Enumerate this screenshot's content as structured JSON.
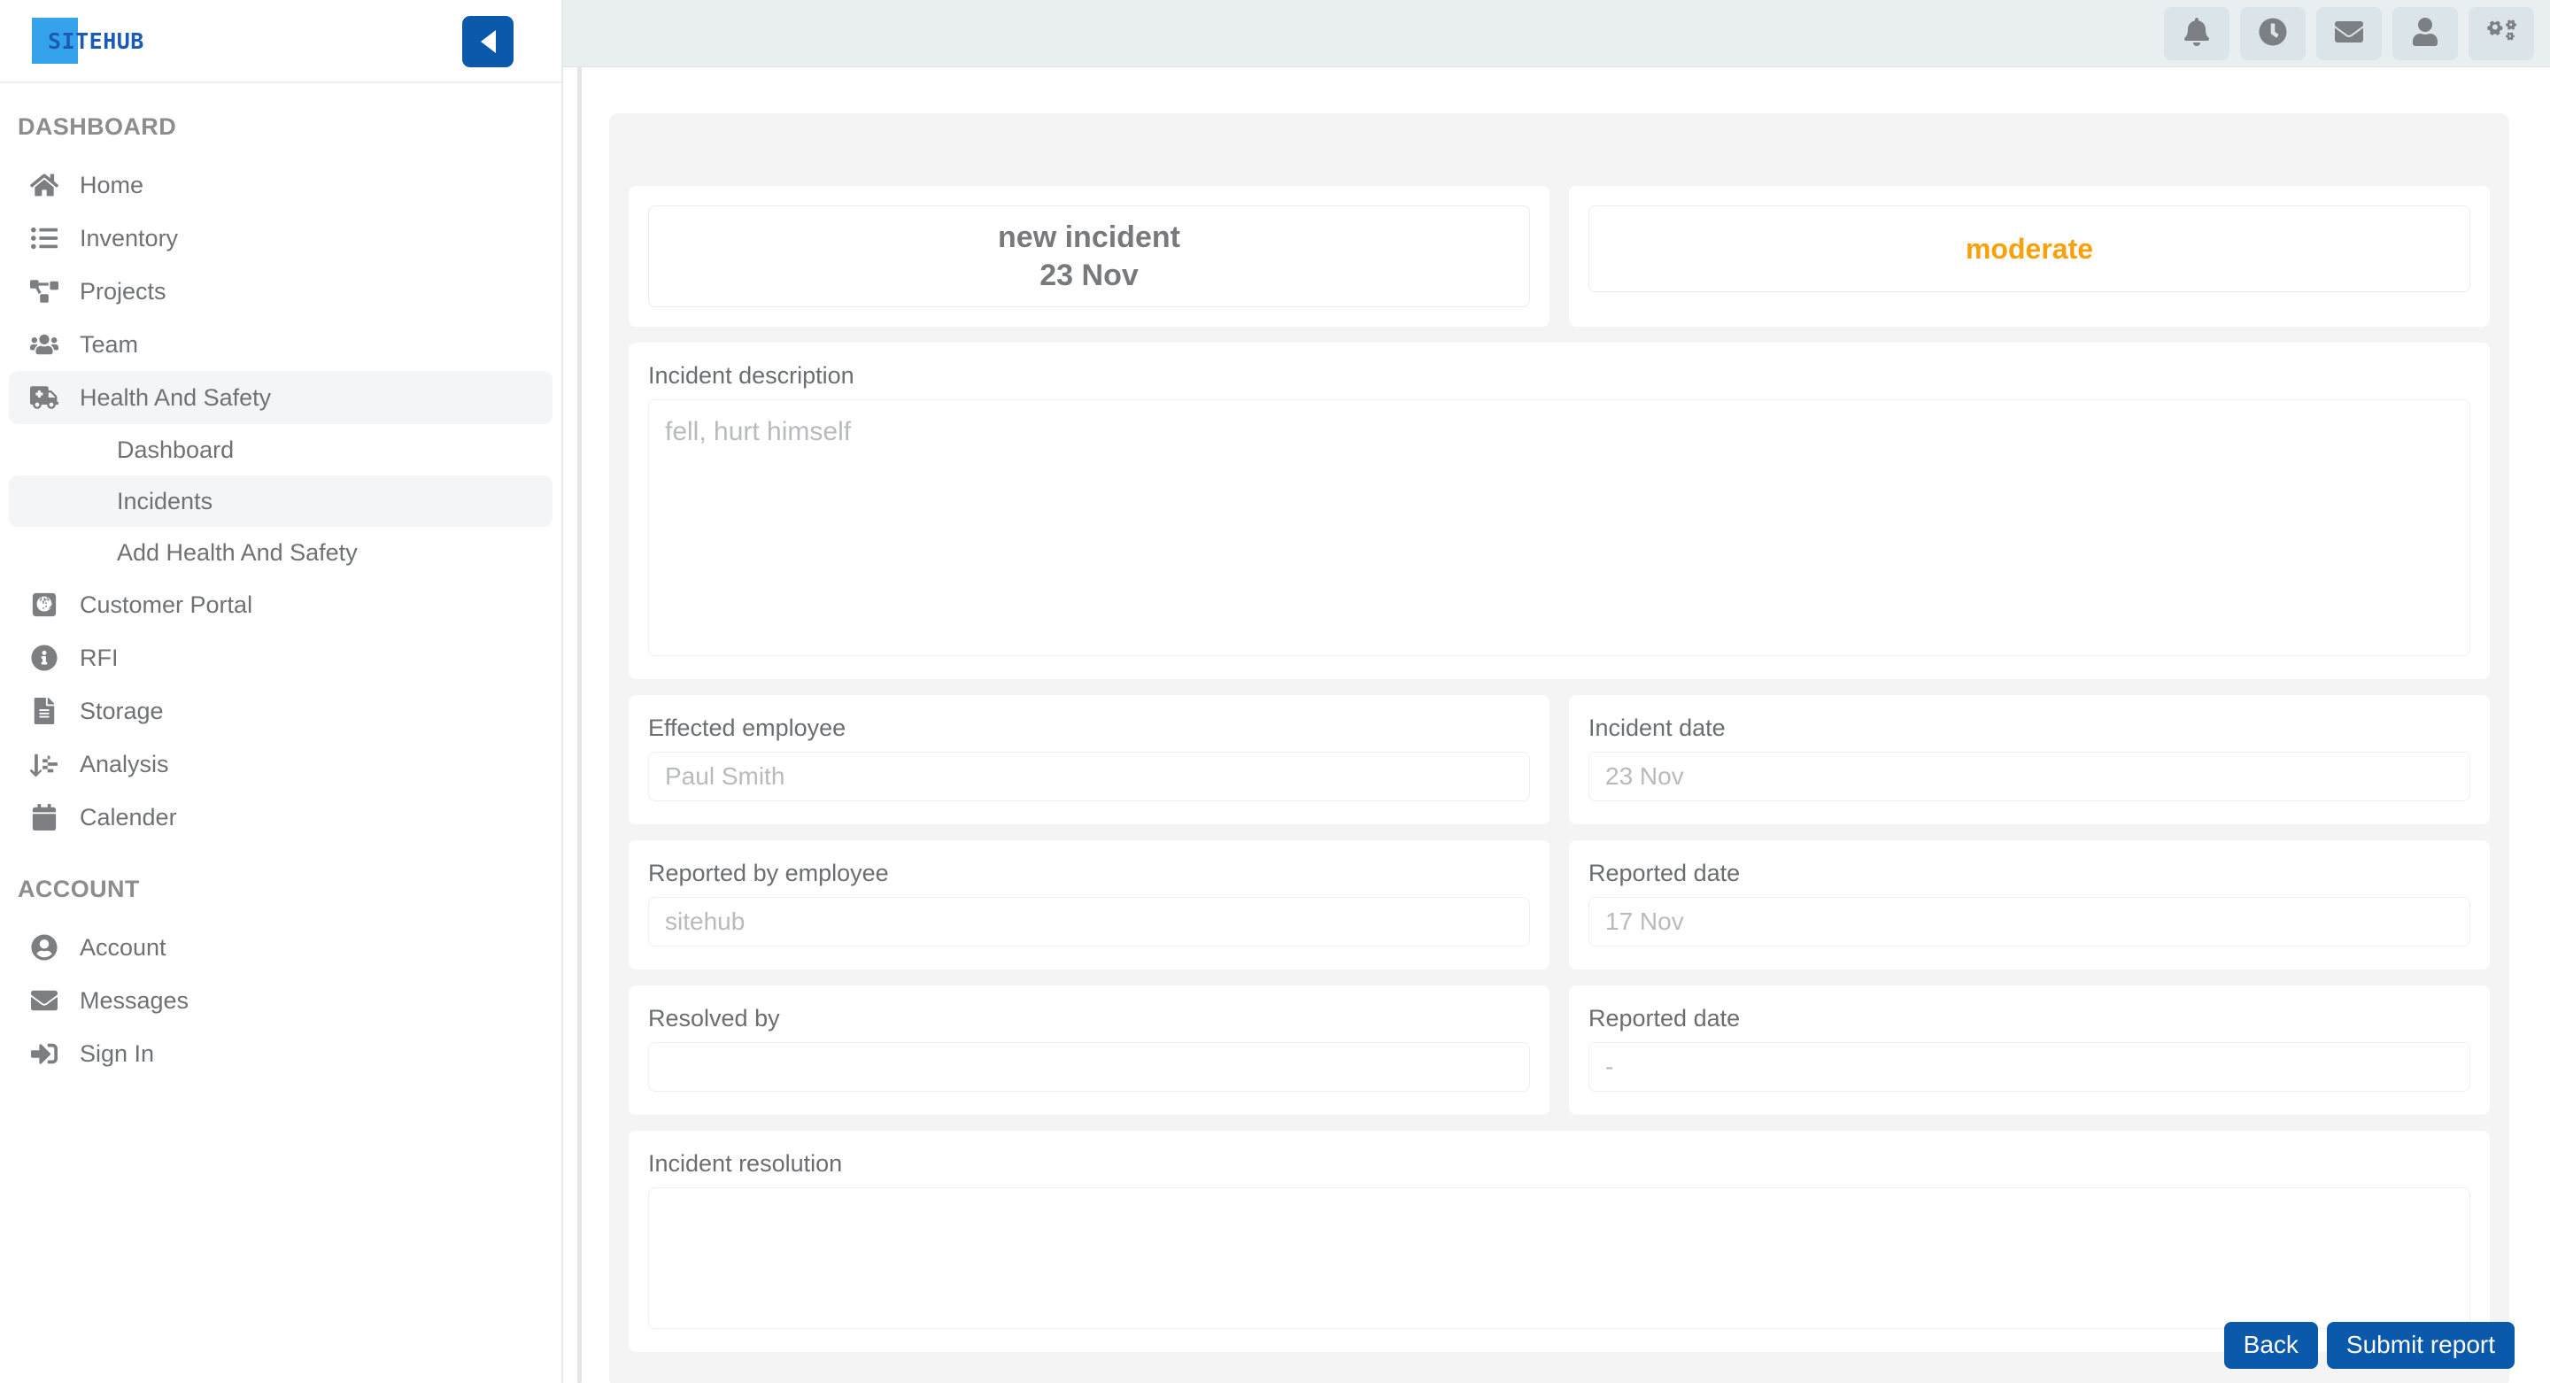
{
  "brand": {
    "name": "SITEHUB"
  },
  "sidebar": {
    "collapse_label": "collapse-sidebar",
    "sections": [
      {
        "title": "DASHBOARD",
        "items": [
          {
            "label": "Home",
            "icon": "home-icon",
            "active": false
          },
          {
            "label": "Inventory",
            "icon": "list-icon",
            "active": false
          },
          {
            "label": "Projects",
            "icon": "project-diagram-icon",
            "active": false
          },
          {
            "label": "Team",
            "icon": "users-icon",
            "active": false
          },
          {
            "label": "Health And Safety",
            "icon": "ambulance-icon",
            "active": true,
            "children": [
              {
                "label": "Dashboard",
                "active": false
              },
              {
                "label": "Incidents",
                "active": true
              },
              {
                "label": "Add Health And Safety",
                "active": false
              }
            ]
          },
          {
            "label": "Customer Portal",
            "icon": "passport-icon",
            "active": false
          },
          {
            "label": "RFI",
            "icon": "info-circle-icon",
            "active": false
          },
          {
            "label": "Storage",
            "icon": "file-alt-icon",
            "active": false
          },
          {
            "label": "Analysis",
            "icon": "sort-amount-down-icon",
            "active": false
          },
          {
            "label": "Calender",
            "icon": "calendar-icon",
            "active": false
          }
        ]
      },
      {
        "title": "ACCOUNT",
        "items": [
          {
            "label": "Account",
            "icon": "user-circle-icon",
            "active": false
          },
          {
            "label": "Messages",
            "icon": "envelope-icon",
            "active": false
          },
          {
            "label": "Sign In",
            "icon": "sign-in-icon",
            "active": false
          }
        ]
      }
    ]
  },
  "topbar": {
    "icons": [
      {
        "name": "bell-icon",
        "label": "Notifications"
      },
      {
        "name": "clock-icon",
        "label": "Recent activity"
      },
      {
        "name": "envelope-icon",
        "label": "Messages"
      },
      {
        "name": "user-icon",
        "label": "Profile"
      },
      {
        "name": "cogs-icon",
        "label": "Settings"
      }
    ]
  },
  "incident": {
    "hero": {
      "title": "new incident",
      "date": "23 Nov",
      "severity": "moderate",
      "severity_color": "#f9a00b"
    },
    "description": {
      "label": "Incident description",
      "value": "fell, hurt himself"
    },
    "effected_employee": {
      "label": "Effected employee",
      "value": "Paul Smith"
    },
    "incident_date": {
      "label": "Incident date",
      "value": "23 Nov"
    },
    "reported_by_employee": {
      "label": "Reported by employee",
      "value": "sitehub"
    },
    "reported_date": {
      "label": "Reported date",
      "value": "17 Nov"
    },
    "resolved_by": {
      "label": "Resolved by",
      "value": ""
    },
    "resolved_reported_date": {
      "label": "Reported date",
      "value": "-"
    },
    "resolution": {
      "label": "Incident resolution",
      "value": ""
    }
  },
  "actions": {
    "back": "Back",
    "submit": "Submit report"
  }
}
